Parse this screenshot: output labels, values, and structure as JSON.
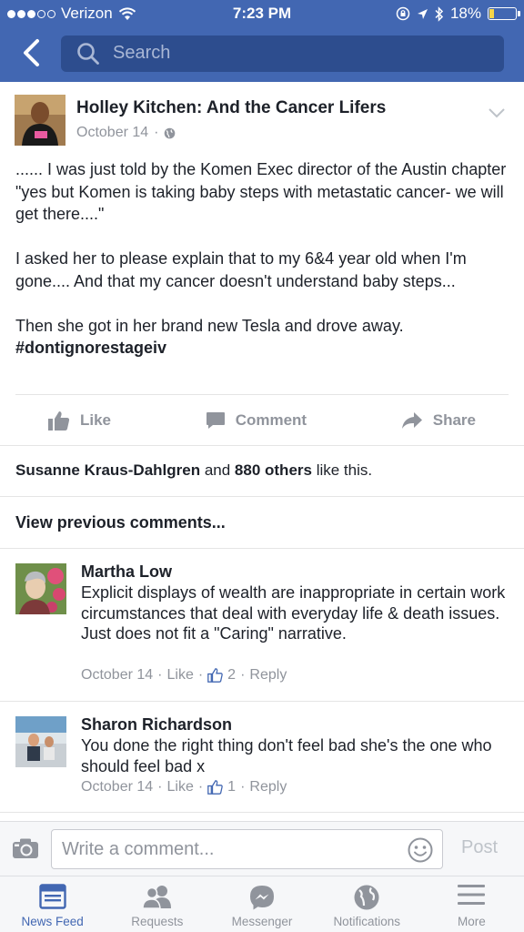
{
  "status_bar": {
    "carrier": "Verizon",
    "time": "7:23 PM",
    "battery": "18%",
    "battery_level": 0.18
  },
  "nav": {
    "search_placeholder": "Search"
  },
  "post": {
    "author": "Holley Kitchen: And the Cancer Lifers",
    "date": "October 14",
    "paragraphs": [
      "...... I was just told by the Komen Exec director of the Austin chapter \"yes but Komen is taking baby steps with metastatic cancer- we will get there....\"",
      "I asked her to please explain that to my 6&4 year old when I'm gone.... And that my cancer doesn't understand baby steps...",
      "Then she got in her brand new Tesla and drove away."
    ],
    "hashtag": "#dontignorestageiv",
    "actions": {
      "like": "Like",
      "comment": "Comment",
      "share": "Share"
    },
    "likes_summary": {
      "name": "Susanne Kraus-Dahlgren",
      "and": " and ",
      "others": "880 others",
      "suffix": " like this."
    },
    "view_previous": "View previous comments..."
  },
  "comments": [
    {
      "name": "Martha Low",
      "text": "Explicit displays of wealth are inappropriate in certain work circumstances that deal with everyday life & death issues. Just does not fit a \"Caring\" narrative.",
      "date": "October 14",
      "like": "Like",
      "likes": "2",
      "reply": "Reply"
    },
    {
      "name": "Sharon Richardson",
      "text": "You done the right thing don't feel bad she's the one who should feel bad x",
      "date": "October 14",
      "like": "Like",
      "likes": "1",
      "reply": "Reply"
    }
  ],
  "composer": {
    "placeholder": "Write a comment...",
    "post_label": "Post"
  },
  "tabs": [
    {
      "label": "News Feed",
      "icon": "news-feed-icon",
      "active": true
    },
    {
      "label": "Requests",
      "icon": "friends-icon",
      "active": false
    },
    {
      "label": "Messenger",
      "icon": "messenger-icon",
      "active": false
    },
    {
      "label": "Notifications",
      "icon": "globe-icon",
      "active": false
    },
    {
      "label": "More",
      "icon": "menu-icon",
      "active": false
    }
  ],
  "colors": {
    "brand": "#4267b2",
    "muted": "#90949c",
    "text": "#1d2129"
  }
}
